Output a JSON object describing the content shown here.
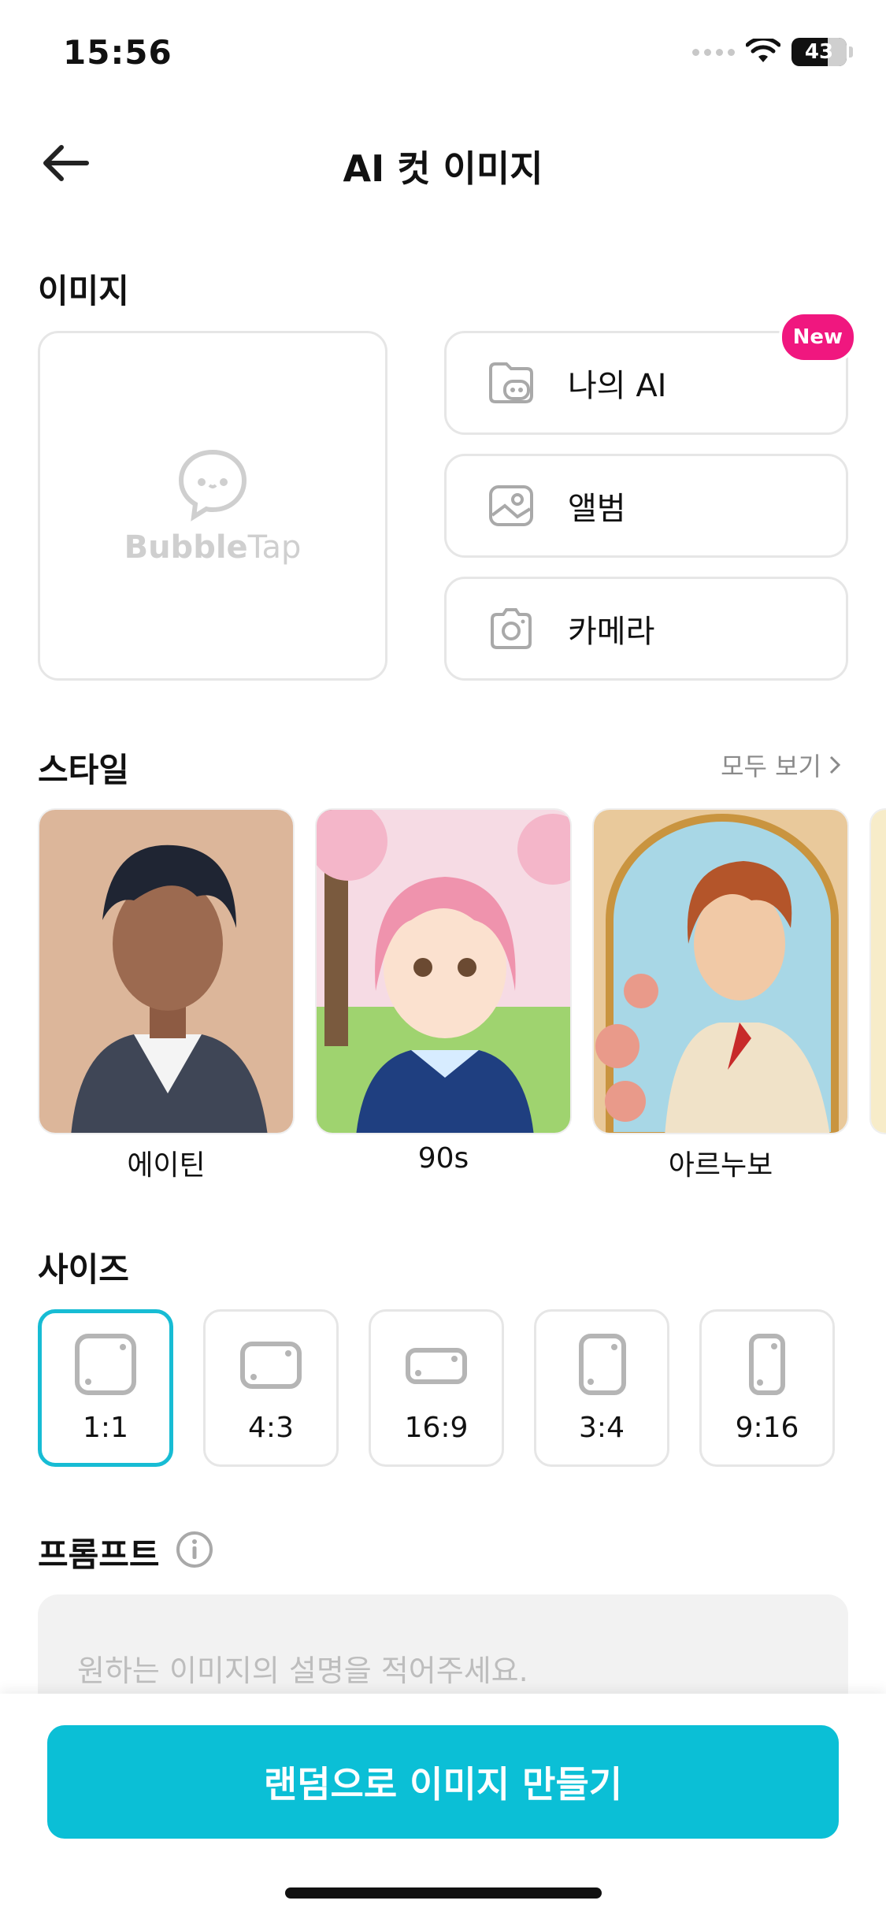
{
  "status_bar": {
    "time": "15:56",
    "battery": "43"
  },
  "header": {
    "title": "AI 컷 이미지"
  },
  "image_section": {
    "label": "이미지",
    "preview_brand_bold": "Bubble",
    "preview_brand_light": "Tap",
    "sources": [
      {
        "label": "나의 AI",
        "icon": "folder-face-icon",
        "badge": "New"
      },
      {
        "label": "앨범",
        "icon": "image-icon"
      },
      {
        "label": "카메라",
        "icon": "camera-icon"
      }
    ]
  },
  "style_section": {
    "label": "스타일",
    "see_all": "모두 보기",
    "styles": [
      {
        "label": "에이틴"
      },
      {
        "label": "90s"
      },
      {
        "label": "아르누보"
      }
    ]
  },
  "size_section": {
    "label": "사이즈",
    "selected": "1:1",
    "sizes": [
      {
        "label": "1:1"
      },
      {
        "label": "4:3"
      },
      {
        "label": "16:9"
      },
      {
        "label": "3:4"
      },
      {
        "label": "9:16"
      }
    ]
  },
  "prompt_section": {
    "label": "프롬프트",
    "placeholder": "원하는 이미지의 설명을 적어주세요."
  },
  "cta": {
    "label": "랜덤으로 이미지 만들기"
  },
  "colors": {
    "accent": "#0bbfd6",
    "badge": "#f0177f",
    "border": "#e6e6e6"
  }
}
